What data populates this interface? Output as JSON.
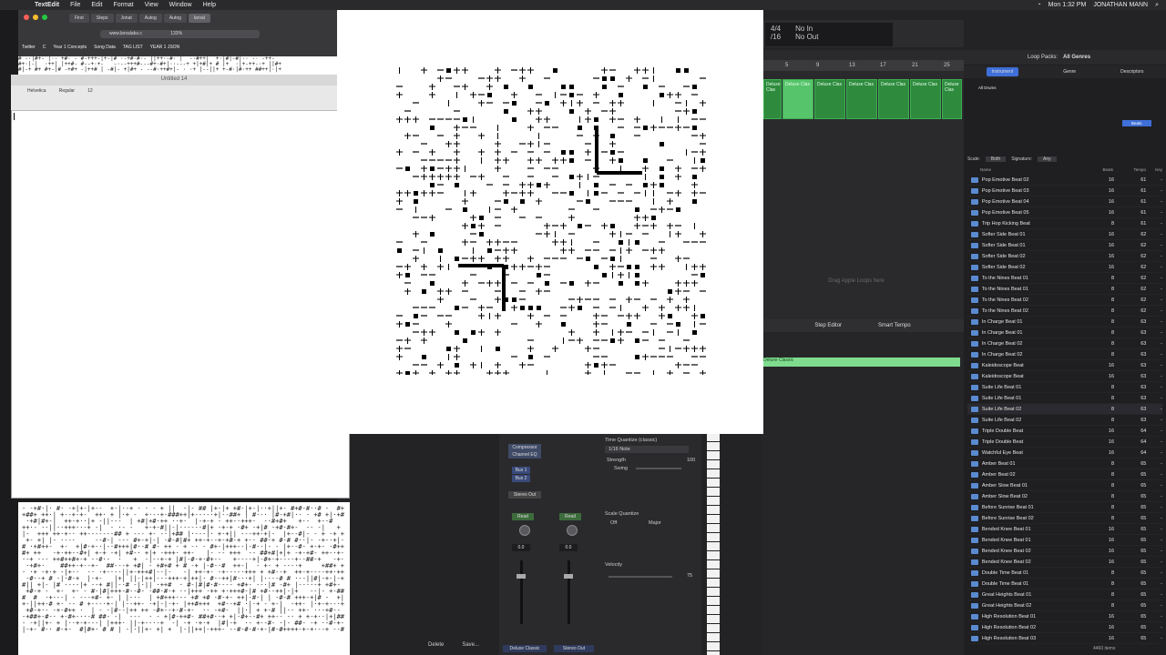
{
  "menubar": {
    "app": "TextEdit",
    "items": [
      "File",
      "Edit",
      "Format",
      "View",
      "Window",
      "Help"
    ],
    "clock": "Mon 1:32 PM",
    "user": "JONATHAN MANN"
  },
  "browser": {
    "tabs": [
      "First",
      "Steps",
      "Jonat",
      "Autog",
      "Autog",
      "larval"
    ],
    "address": "www.larvalabs.c",
    "zoom": "133%",
    "bookmarks": [
      "Twitter",
      "C",
      "Year 1 Concepts",
      "Song Data",
      "TAG LIST",
      "YEAR 1 JSON"
    ]
  },
  "textedit": {
    "title": "Untitled 14",
    "font": "Helvetica",
    "style": "Regular",
    "size": "12"
  },
  "logic": {
    "lcd_sig": "4/4",
    "lcd_div": "/16",
    "lcd_in": "No In",
    "lcd_out": "No Out",
    "ruler": [
      "5",
      "9",
      "13",
      "17",
      "21",
      "25"
    ],
    "regions": [
      "Deluxe Clas",
      "Deluxe Clas",
      "Deluxe Clas",
      "Deluxe Clas",
      "Deluxe Clas",
      "Deluxe Clas",
      "Deluxe Clas"
    ],
    "drop_hint": "Drag Apple Loops here",
    "editor_tabs": [
      "Step Editor",
      "Smart Tempo"
    ],
    "piano_region": "Deluxe Classic",
    "mixer": {
      "plugin": "Compressor",
      "eq": "Channel EQ",
      "bus1": "Bus 1",
      "bus2": "Bus 2",
      "out": "Stereo Out",
      "read": "Read",
      "vol1": "0.0",
      "vol2": "0.0",
      "name1": "Deluxe Classic",
      "name2": "Stereo Out"
    },
    "quantize": {
      "title": "Time Quantize (classic)",
      "value": "1/16 Note",
      "strength_label": "Strength",
      "strength": "100",
      "swing_label": "Swing",
      "scale_title": "Scale Quantize",
      "scale_off": "Off",
      "scale_mode": "Major",
      "velocity_label": "Velocity",
      "velocity": "75"
    },
    "footer": [
      "Delete",
      "Save..."
    ]
  },
  "loops": {
    "header_label": "Loop Packs:",
    "header_value": "All Genres",
    "tabs": [
      "Instrument",
      "Genre",
      "Descriptors"
    ],
    "sub_all": "All Drums",
    "selected_cat": "Beats",
    "scale_label": "Scale:",
    "scale_value": "Both",
    "sig_label": "Signature:",
    "sig_value": "Any",
    "columns": [
      "Name",
      "Beats",
      "Tempo",
      "Key"
    ],
    "rows": [
      {
        "name": "Pop Emotive Beat 02",
        "beats": "16",
        "tempo": "61",
        "key": "-"
      },
      {
        "name": "Pop Emotive Beat 03",
        "beats": "16",
        "tempo": "61",
        "key": "-"
      },
      {
        "name": "Pop Emotive Beat 04",
        "beats": "16",
        "tempo": "61",
        "key": "-"
      },
      {
        "name": "Pop Emotive Beat 05",
        "beats": "16",
        "tempo": "61",
        "key": "-"
      },
      {
        "name": "Trip Hop Kicking Beat",
        "beats": "8",
        "tempo": "61",
        "key": "-"
      },
      {
        "name": "Softer Side Beat 01",
        "beats": "16",
        "tempo": "62",
        "key": "-"
      },
      {
        "name": "Softer Side Beat 01",
        "beats": "16",
        "tempo": "62",
        "key": "-"
      },
      {
        "name": "Softer Side Beat 02",
        "beats": "16",
        "tempo": "62",
        "key": "-"
      },
      {
        "name": "Softer Side Beat 02",
        "beats": "16",
        "tempo": "62",
        "key": "-"
      },
      {
        "name": "To the Nines Beat 01",
        "beats": "8",
        "tempo": "62",
        "key": "-"
      },
      {
        "name": "To the Nines Beat 01",
        "beats": "8",
        "tempo": "62",
        "key": "-"
      },
      {
        "name": "To the Nines Beat 02",
        "beats": "8",
        "tempo": "62",
        "key": "-"
      },
      {
        "name": "To the Nines Beat 02",
        "beats": "8",
        "tempo": "62",
        "key": "-"
      },
      {
        "name": "In Charge Beat 01",
        "beats": "8",
        "tempo": "63",
        "key": "-"
      },
      {
        "name": "In Charge Beat 01",
        "beats": "8",
        "tempo": "63",
        "key": "-"
      },
      {
        "name": "In Charge Beat 02",
        "beats": "8",
        "tempo": "63",
        "key": "-"
      },
      {
        "name": "In Charge Beat 02",
        "beats": "8",
        "tempo": "63",
        "key": "-"
      },
      {
        "name": "Kaleidoscope Beat",
        "beats": "16",
        "tempo": "63",
        "key": "-"
      },
      {
        "name": "Kaleidoscope Beat",
        "beats": "16",
        "tempo": "63",
        "key": "-"
      },
      {
        "name": "Suite Life Beat 01",
        "beats": "8",
        "tempo": "63",
        "key": "-"
      },
      {
        "name": "Suite Life Beat 01",
        "beats": "8",
        "tempo": "63",
        "key": "-"
      },
      {
        "name": "Suite Life Beat 02",
        "beats": "8",
        "tempo": "63",
        "key": "-"
      },
      {
        "name": "Suite Life Beat 02",
        "beats": "8",
        "tempo": "63",
        "key": "-"
      },
      {
        "name": "Triple Double Beat",
        "beats": "16",
        "tempo": "64",
        "key": "-"
      },
      {
        "name": "Triple Double Beat",
        "beats": "16",
        "tempo": "64",
        "key": "-"
      },
      {
        "name": "Watchful Eye Beat",
        "beats": "16",
        "tempo": "64",
        "key": "-"
      },
      {
        "name": "Amber Beat 01",
        "beats": "8",
        "tempo": "65",
        "key": "-"
      },
      {
        "name": "Amber Beat 02",
        "beats": "8",
        "tempo": "65",
        "key": "-"
      },
      {
        "name": "Amber Slow Beat 01",
        "beats": "8",
        "tempo": "65",
        "key": "-"
      },
      {
        "name": "Amber Slow Beat 02",
        "beats": "8",
        "tempo": "65",
        "key": "-"
      },
      {
        "name": "Before Sunrise Beat 01",
        "beats": "8",
        "tempo": "65",
        "key": "-"
      },
      {
        "name": "Before Sunrise Beat 02",
        "beats": "8",
        "tempo": "65",
        "key": "-"
      },
      {
        "name": "Bended Knee Beat 01",
        "beats": "16",
        "tempo": "65",
        "key": "-"
      },
      {
        "name": "Bended Knee Beat 01",
        "beats": "16",
        "tempo": "65",
        "key": "-"
      },
      {
        "name": "Bended Knee Beat 02",
        "beats": "16",
        "tempo": "65",
        "key": "-"
      },
      {
        "name": "Bended Knee Beat 02",
        "beats": "16",
        "tempo": "65",
        "key": "-"
      },
      {
        "name": "Double Time Beat 01",
        "beats": "8",
        "tempo": "65",
        "key": "-"
      },
      {
        "name": "Double Time Beat 01",
        "beats": "8",
        "tempo": "65",
        "key": "-"
      },
      {
        "name": "Great Heights Beat 01",
        "beats": "8",
        "tempo": "65",
        "key": "-"
      },
      {
        "name": "Great Heights Beat 02",
        "beats": "8",
        "tempo": "65",
        "key": "-"
      },
      {
        "name": "High Resolution Beat 01",
        "beats": "16",
        "tempo": "65",
        "key": "-"
      },
      {
        "name": "High Resolution Beat 02",
        "beats": "16",
        "tempo": "65",
        "key": "-"
      },
      {
        "name": "High Resolution Beat 03",
        "beats": "16",
        "tempo": "65",
        "key": "-"
      }
    ],
    "count": "4460 items"
  },
  "colors": {
    "region_green": "#2e8b3e",
    "accent_blue": "#3f6fd8"
  }
}
